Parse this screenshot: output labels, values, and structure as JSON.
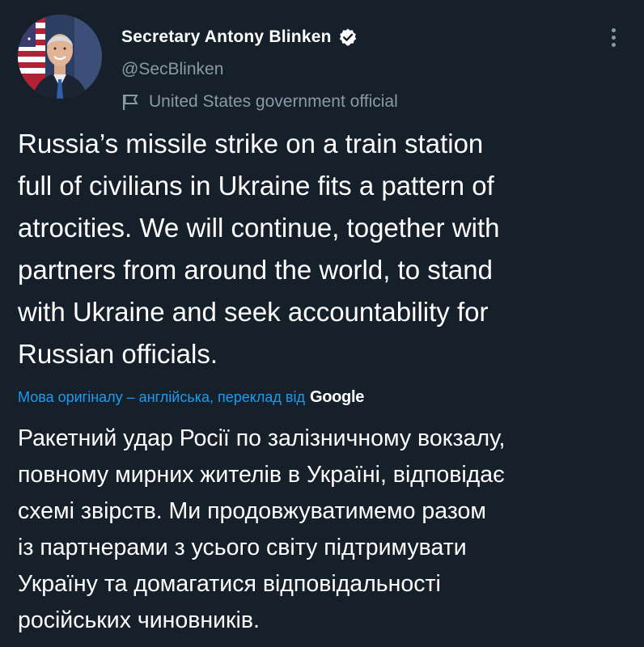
{
  "author": {
    "display_name": "Secretary Antony Blinken",
    "handle": "@SecBlinken",
    "label": "United States government official",
    "verified_icon": "verified-badge-icon",
    "label_icon": "government-flag-icon",
    "avatar": "avatar-photo"
  },
  "menu": {
    "icon": "more-options-icon"
  },
  "tweet": {
    "text": "Russia’s missile strike on a train station\nfull of civilians in Ukraine fits a pattern of\natrocities. We will continue, together with\npartners from around the world, to stand\nwith Ukraine and seek accountability for\nRussian officials."
  },
  "translation": {
    "source_note": "Мова оригіналу – англійська, переклад від",
    "provider": "Google",
    "text": "Ракетний удар Росії по залізничному вокзалу,\nповному мирних жителів в Україні, відповідає\nсхемі звірств. Ми продовжуватимемо разом\nіз партнерами з усього світу підтримувати\nУкраїну та домагатися відповідальності\nросійських чиновників."
  },
  "colors": {
    "background": "#15202b",
    "primary_text": "#ffffff",
    "secondary_text": "#8b98a5",
    "link": "#1d9bf0"
  }
}
